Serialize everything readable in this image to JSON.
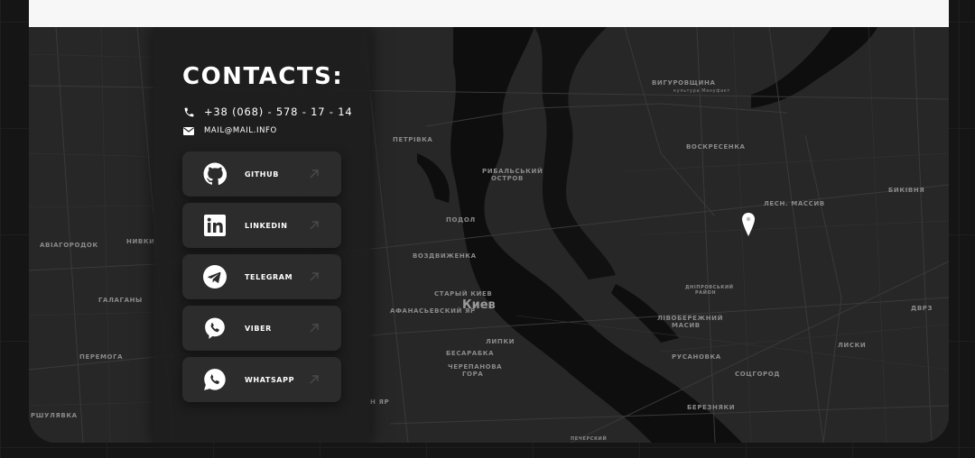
{
  "colors": {
    "page_bg": "#151515",
    "map_bg": "#272727",
    "water": "#0e0e0e",
    "panel": "#1e1e1e",
    "button": "#2c2c2c",
    "text": "#ffffff",
    "pin": "#ffffff"
  },
  "contacts": {
    "title": "CONTACTS:",
    "phone": "+38 (068) - 578 - 17 - 14",
    "email": "MAIL@MAIL.INFO",
    "phone_icon": "phone-icon",
    "email_icon": "envelope-icon"
  },
  "socials": [
    {
      "label": "GITHUB",
      "icon": "github-icon"
    },
    {
      "label": "LINKEDIN",
      "icon": "linkedin-icon"
    },
    {
      "label": "TELEGRAM",
      "icon": "telegram-icon"
    },
    {
      "label": "VIBER",
      "icon": "viber-icon"
    },
    {
      "label": "WHATSAPP",
      "icon": "whatsapp-icon"
    }
  ],
  "map": {
    "city_label": "Киев",
    "labels": {
      "vygurovshchyna": "ВИГУРОВЩИНА",
      "kultura_mall": "культура Мануфакт",
      "petrivka": "ПЕТРІВКА",
      "voskresenka": "ВОСКРЕСЕНКА",
      "rybalskyi": "РИБАЛЬСЬКИЙ",
      "ostrov": "ОСТРОВ",
      "lisovyi_masyv": "ЛЕСН. МАССИВ",
      "bykivnia": "БИКІВНЯ",
      "podil": "ПОДОЛ",
      "vozdvyzhenka": "ВОЗДВИЖЕНКА",
      "avia": "АВІАГОРОДОК",
      "nyvky": "НИВКИ",
      "halahany": "ГАЛАГАНЫ",
      "staryi_kyiv": "СТАРЫЙ КИЕВ",
      "afanasiv": "АФАНАСЬЕВСКИЙ ЯР",
      "dniprovskyi": "ДНІПРОВСЬКИЙ",
      "raion": "РАЙОН",
      "dvrz": "ДВРЗ",
      "livoberezhnyi": "ЛІВОБЕРЕЖНИЙ",
      "masyv": "МАСИВ",
      "lypky": "ЛИПКИ",
      "besarabka": "БЕСАРАБКА",
      "rusanivka": "РУСАНОВКА",
      "lisky": "ЛИСКИ",
      "peremoha": "ПЕРЕМОГА",
      "cherepanova": "ЧЕРЕПАНОВА",
      "hora": "ГОРА",
      "sotsgorod": "СОЦГОРОД",
      "yar": "Н ЯР",
      "berezniaky": "БЕРЕЗНЯКИ",
      "shuliavka": "РШУЛЯВКА",
      "pecherskyi": "ПЕЧЕРСКИЙ"
    }
  }
}
